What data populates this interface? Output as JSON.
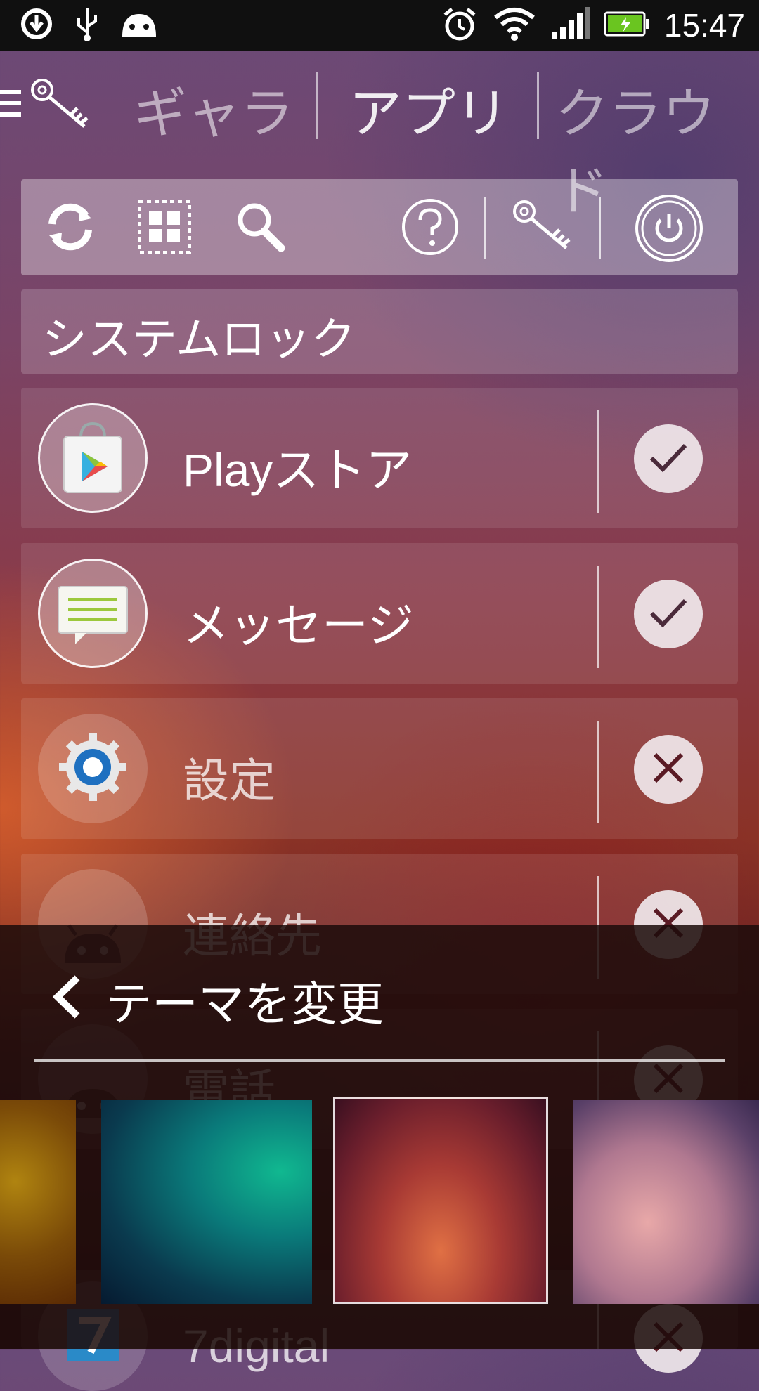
{
  "status_bar": {
    "time": "15:47",
    "left_icons": [
      "sync-icon",
      "usb-icon",
      "android-icon"
    ],
    "right_icons": [
      "alarm-icon",
      "wifi-icon",
      "signal-icon",
      "battery-charging-icon"
    ]
  },
  "tabs": [
    {
      "label": "ギャラ",
      "active": false
    },
    {
      "label": "アプリ",
      "active": true
    },
    {
      "label": "クラウド",
      "active": false
    }
  ],
  "toolbar": {
    "icons": [
      "refresh-icon",
      "grid-select-icon",
      "search-icon",
      "help-icon",
      "key-icon",
      "power-icon"
    ]
  },
  "section": {
    "title": "システムロック"
  },
  "apps": [
    {
      "label_prefix": "Play",
      "label": "ストア",
      "icon": "play-store-icon",
      "locked": true
    },
    {
      "label_prefix": "",
      "label": "メッセージ",
      "icon": "messages-icon",
      "locked": true
    },
    {
      "label_prefix": "",
      "label": "設定",
      "icon": "settings-icon",
      "locked": false
    },
    {
      "label_prefix": "",
      "label": "連絡先",
      "icon": "android-icon",
      "locked": false
    },
    {
      "label_prefix": "",
      "label": "電話",
      "icon": "android-icon",
      "locked": false
    },
    {
      "label_prefix": "",
      "label": "7digital",
      "icon": "7digital-icon",
      "locked": false
    }
  ],
  "theme_panel": {
    "title": "テーマを変更",
    "themes": [
      {
        "name": "orange",
        "selected": false
      },
      {
        "name": "teal",
        "selected": false
      },
      {
        "name": "red-purple",
        "selected": true
      },
      {
        "name": "pink-blur",
        "selected": false
      }
    ]
  },
  "colors": {
    "check_color": "#4a2a3a",
    "cross_color": "#5a1a24"
  }
}
